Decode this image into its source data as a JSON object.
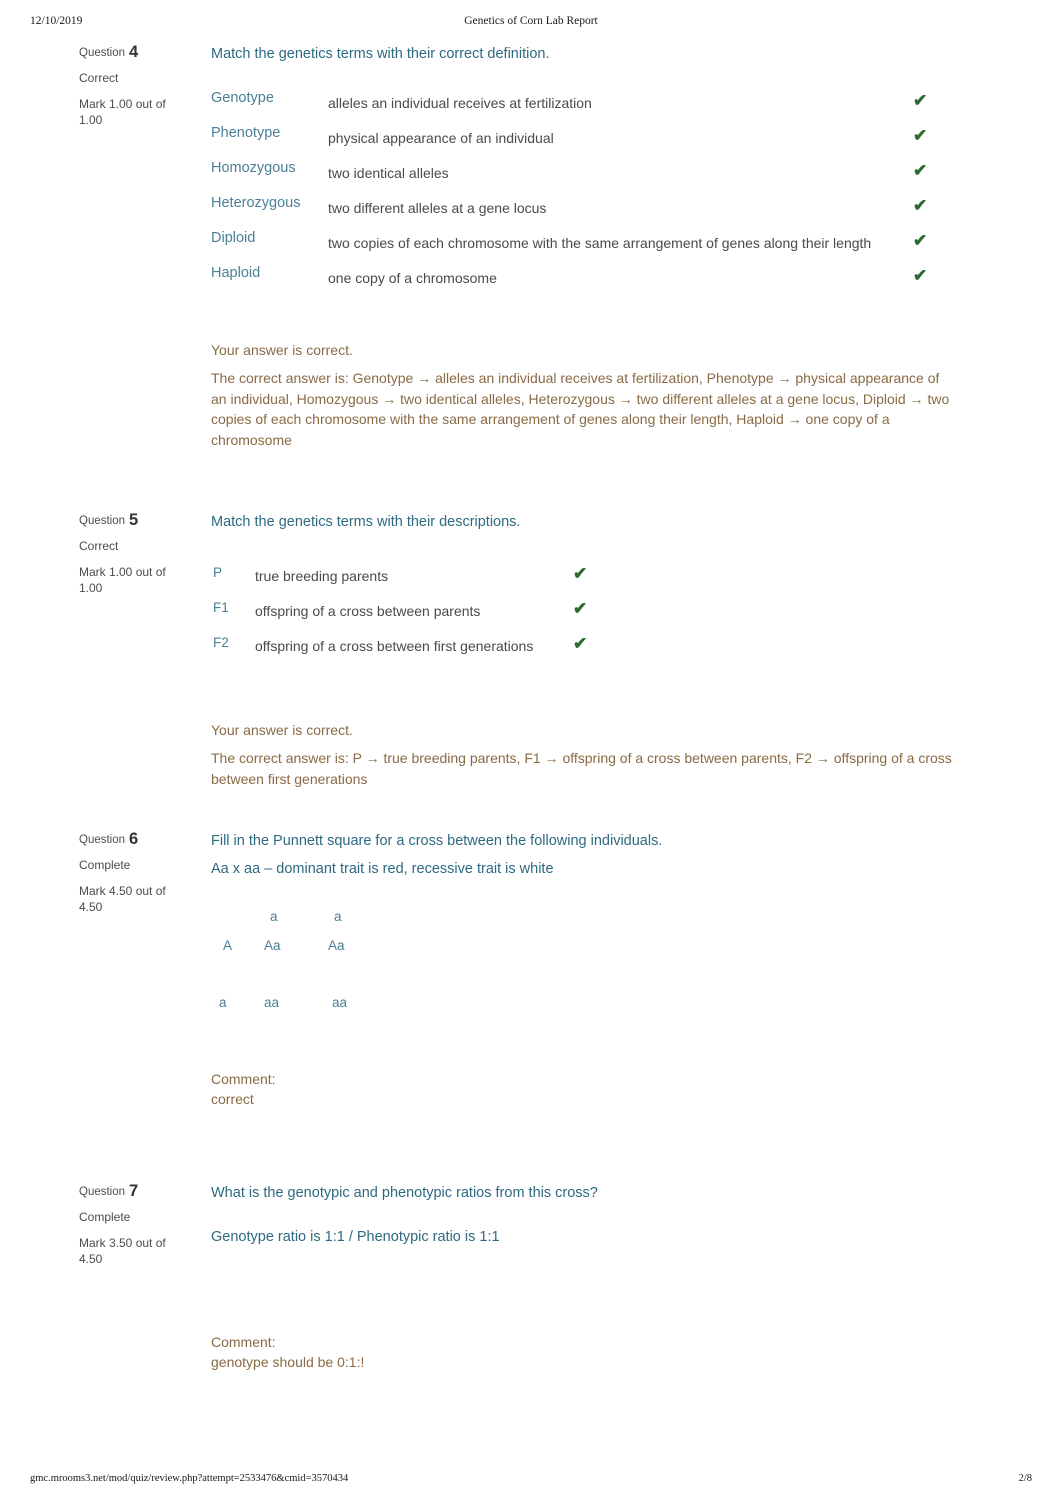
{
  "print_header": {
    "date": "12/10/2019",
    "title": "Genetics of Corn Lab Report"
  },
  "print_footer": {
    "url": "gmc.mrooms3.net/mod/quiz/review.php?attempt=2533476&cmid=3570434",
    "page": "2/8"
  },
  "colors": {
    "question_text": "#2d6a82",
    "term_text": "#4a7f96",
    "definition_text": "#4a4a4a",
    "feedback_text": "#8a6a44",
    "tick_green": "#2d6a2d",
    "info_text": "#4d4d4d",
    "background": "#ffffff"
  },
  "icons": {
    "correct_tick": "✔"
  },
  "questions": [
    {
      "label": "Question",
      "number": "4",
      "state": "Correct",
      "mark": "Mark 1.00 out of 1.00",
      "prompt": "Match the genetics terms with their correct definition.",
      "matches": [
        {
          "term": "Genotype",
          "definition": "alleles an individual receives at fertilization"
        },
        {
          "term": "Phenotype",
          "definition": "physical appearance of an individual"
        },
        {
          "term": "Homozygous",
          "definition": "two identical alleles"
        },
        {
          "term": "Heterozygous",
          "definition": "two different alleles at a gene locus"
        },
        {
          "term": "Diploid",
          "definition": "two copies of each chromosome with the same arrangement of genes along their length"
        },
        {
          "term": "Haploid",
          "definition": "one copy of a chromosome"
        }
      ],
      "feedback_correct": "Your answer is correct.",
      "feedback_answer": "The correct answer is: Genotype → alleles an individual receives at fertilization, Phenotype → physical appearance of an individual, Homozygous → two identical alleles, Heterozygous → two different alleles at a gene locus, Diploid → two copies of each chromosome with the same arrangement of genes along their length, Haploid → one copy of a chromosome"
    },
    {
      "label": "Question",
      "number": "5",
      "state": "Correct",
      "mark": "Mark 1.00 out of 1.00",
      "prompt": "Match the genetics terms with their descriptions.",
      "matches": [
        {
          "term": "P",
          "definition": "true breeding parents"
        },
        {
          "term": "F1",
          "definition": "offspring of a cross between parents"
        },
        {
          "term": "F2",
          "definition": "offspring of a cross between first generations"
        }
      ],
      "feedback_correct": "Your answer is correct.",
      "feedback_answer": "The correct answer is: P → true breeding parents, F1 → offspring of a cross between parents, F2 → offspring of a cross between first generations"
    },
    {
      "label": "Question",
      "number": "6",
      "state": "Complete",
      "mark": "Mark 4.50 out of 4.50",
      "prompt": "Fill in the Punnett square for a cross between the following individuals.",
      "prompt2": "Aa x aa – dominant trait is red, recessive trait is white",
      "punnett": {
        "col_header_1": "a",
        "col_header_2": "a",
        "row1_label": "A",
        "row1_cell1": "Aa",
        "row1_cell2": "Aa",
        "row2_label": "a",
        "row2_cell1": "aa",
        "row2_cell2": "aa"
      },
      "comment_label": "Comment:",
      "comment_text": "correct"
    },
    {
      "label": "Question",
      "number": "7",
      "state": "Complete",
      "mark": "Mark 3.50 out of 4.50",
      "prompt": "What is the genotypic and phenotypic ratios from this cross?",
      "answer": "Genotype ratio is 1:1 / Phenotypic ratio is 1:1",
      "comment_label": "Comment:",
      "comment_text": "genotype should be 0:1:!"
    }
  ]
}
